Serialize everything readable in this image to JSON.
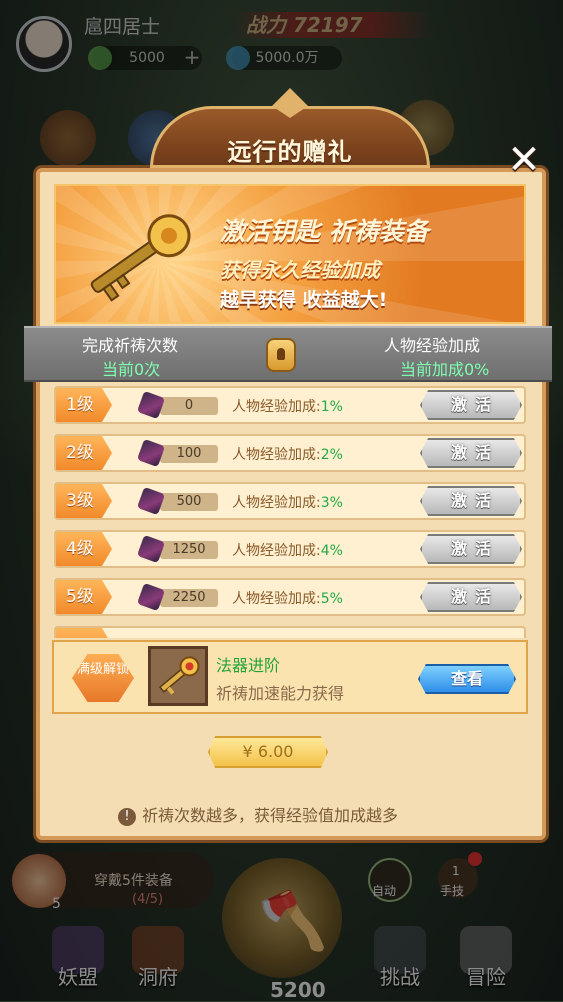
{
  "player": {
    "name": "扈四居士",
    "power_label": "战力 72197",
    "coins": "5000",
    "gems": "5000.0万",
    "plus": "+"
  },
  "modal": {
    "title": "远行的赠礼",
    "close": "✕",
    "banner": {
      "headline": "激活钥匙  祈祷装备",
      "subline": "获得永久经验加成",
      "slogan": "越早获得 收益越大!"
    },
    "stats": {
      "left_label": "完成祈祷次数",
      "left_value": "当前0次",
      "right_label": "人物经验加成",
      "right_value": "当前加成0%"
    },
    "rows": [
      {
        "level": "1级",
        "count": "0",
        "bonus_label": "人物经验加成:",
        "bonus_value": "1%",
        "button": "激活"
      },
      {
        "level": "2级",
        "count": "100",
        "bonus_label": "人物经验加成:",
        "bonus_value": "2%",
        "button": "激活"
      },
      {
        "level": "3级",
        "count": "500",
        "bonus_label": "人物经验加成:",
        "bonus_value": "3%",
        "button": "激活"
      },
      {
        "level": "4级",
        "count": "1250",
        "bonus_label": "人物经验加成:",
        "bonus_value": "4%",
        "button": "激活"
      },
      {
        "level": "5级",
        "count": "2250",
        "bonus_label": "人物经验加成:",
        "bonus_value": "5%",
        "button": "激活"
      }
    ],
    "artifact": {
      "unlock_badge": "满级解锁",
      "title": "法器进阶",
      "desc": "祈祷加速能力获得",
      "view_button": "查看"
    },
    "price": "¥ 6.00",
    "footer_note": "祈祷次数越多，获得经验值加成越多"
  },
  "bottom": {
    "equip_task": "穿戴5件装备",
    "equip_progress": "(4/5)",
    "equip_count": "5",
    "auto_label": "自动",
    "hand_label": "手技",
    "hand_num": "1",
    "nav": [
      "妖盟",
      "洞府",
      "挑战",
      "冒险"
    ],
    "fight_amount": "5200"
  },
  "colors": {
    "accent_orange": "#f18a2a",
    "bonus_green": "#22aa44",
    "panel_bg": "#f4ddb2",
    "view_blue": "#2e8ee8"
  }
}
